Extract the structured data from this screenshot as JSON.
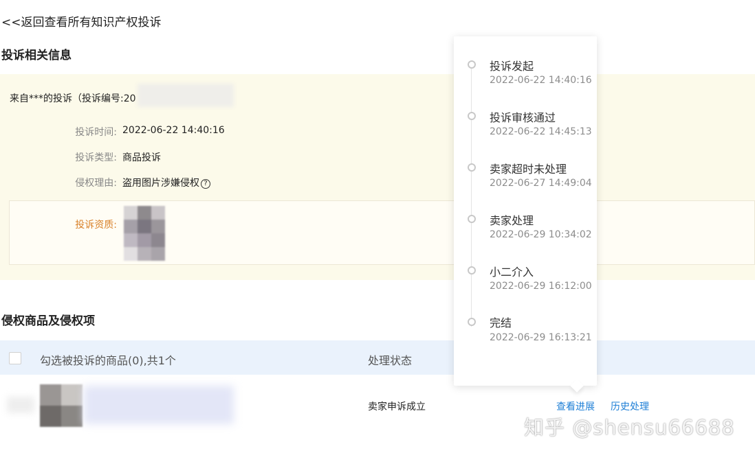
{
  "back_link": "<<返回查看所有知识产权投诉",
  "complaint_section": {
    "title": "投诉相关信息",
    "from_text": "来自***的投诉（投诉编号:20",
    "fields": [
      {
        "label": "投诉时间:",
        "value": "2022-06-22 14:40:16"
      },
      {
        "label": "投诉类型:",
        "value": "商品投诉"
      },
      {
        "label": "侵权理由:",
        "value": "盗用图片涉嫌侵权"
      }
    ],
    "help_icon_glyph": "?",
    "qualification_label": "投诉资质:"
  },
  "goods_section": {
    "title": "侵权商品及侵权项",
    "header": {
      "select_text": "勾选被投诉的商品(0),共1个",
      "status_col": "处理状态"
    },
    "row": {
      "status": "卖家申诉成立",
      "action_progress": "查看进展",
      "action_history": "历史处理"
    }
  },
  "progress_popover": {
    "steps": [
      {
        "title": "投诉发起",
        "time": "2022-06-22 14:40:16"
      },
      {
        "title": "投诉审核通过",
        "time": "2022-06-22 14:45:13"
      },
      {
        "title": "卖家超时未处理",
        "time": "2022-06-27 14:49:04"
      },
      {
        "title": "卖家处理",
        "time": "2022-06-29 10:34:02"
      },
      {
        "title": "小二介入",
        "time": "2022-06-29 16:12:00"
      },
      {
        "title": "完结",
        "time": "2022-06-29 16:13:21"
      }
    ]
  },
  "watermark": "知乎 @shensu66688",
  "colors": {
    "info_bg": "#fcfaea",
    "table_header_bg": "#eaf2fc",
    "link": "#1e7fd6",
    "qualification_label": "#d9822b"
  }
}
